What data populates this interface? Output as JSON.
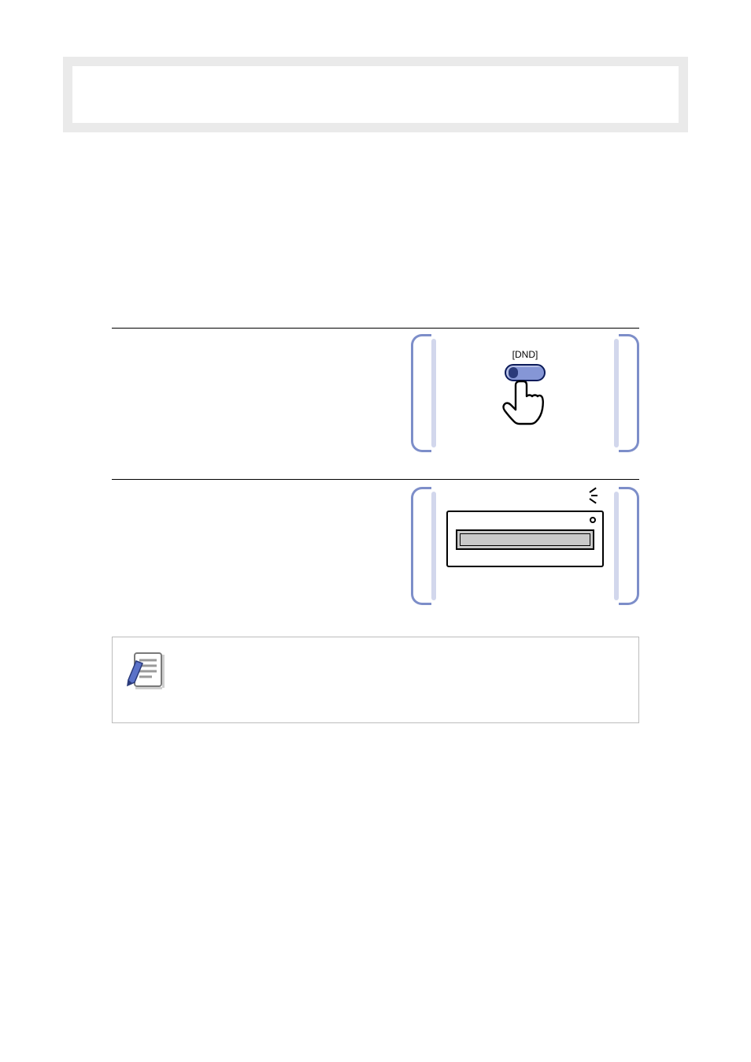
{
  "banner": {
    "title": ""
  },
  "steps": [
    {
      "id": "step-1",
      "label": "",
      "text": "",
      "illustration": {
        "button_label": "[DND]",
        "icon": "hand-press-icon"
      }
    },
    {
      "id": "step-2",
      "label": "",
      "text": "",
      "illustration": {
        "icon": "lcd-display-icon",
        "lamp": "blinking"
      }
    }
  ],
  "note": {
    "icon": "document-note-icon",
    "text": ""
  }
}
